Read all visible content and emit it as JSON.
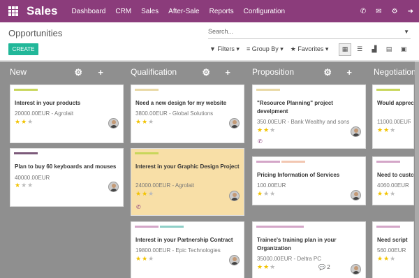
{
  "app": {
    "brand": "Sales",
    "apps_icon": "grid-icon"
  },
  "nav": [
    "Dashboard",
    "CRM",
    "Sales",
    "After-Sale",
    "Reports",
    "Configuration"
  ],
  "top_icons": [
    "phone-icon",
    "mail-icon",
    "gear-icon",
    "logout-icon"
  ],
  "page": {
    "title": "Opportunities",
    "create_label": "CREATE"
  },
  "search": {
    "placeholder": "Search..."
  },
  "filters": {
    "filters": "Filters",
    "group_by": "Group By",
    "favorites": "Favorites"
  },
  "views": [
    "kanban-view-icon",
    "list-view-icon",
    "graph-view-icon",
    "calendar-view-icon",
    "pivot-view-icon"
  ],
  "colors": {
    "topbar": "#8b3c7b",
    "create": "#21b799",
    "board": "#8f8f8f",
    "highlight": "#f8dfa7",
    "star": "#f2c300"
  },
  "columns": [
    {
      "title": "New",
      "cards": [
        {
          "title": "Interest in your products",
          "sub": "20000.00EUR - Agrolait",
          "stars": 2,
          "tags": [
            "#c8d65b"
          ]
        },
        {
          "title": "Plan to buy 60 keyboards and mouses",
          "sub": "40000.00EUR",
          "stars": 1,
          "tags": [
            "#7c5a7a"
          ]
        }
      ]
    },
    {
      "title": "Qualification",
      "cards": [
        {
          "title": "Need a new design for my website",
          "sub": "3800.00EUR - Global Solutions",
          "stars": 2,
          "tags": [
            "#e9d9a5"
          ]
        },
        {
          "title": "Interest in your Graphic Design Project",
          "sub": "24000.00EUR - Agrolait",
          "stars": 2,
          "tags": [
            "#c8d65b"
          ],
          "highlight": true,
          "phone": true
        },
        {
          "title": "Interest in your Partnership Contract",
          "sub": "19800.00EUR - Epic Technologies",
          "stars": 2,
          "tags": [
            "#d4a6c8",
            "#8fd0c8"
          ]
        }
      ]
    },
    {
      "title": "Proposition",
      "cards": [
        {
          "title": "\"Resource Planning\" project develpment",
          "sub": "350.00EUR - Bank Wealthy and sons",
          "stars": 2,
          "tags": [
            "#e9d9a5"
          ],
          "phone": true
        },
        {
          "title": "Pricing Information of Services",
          "sub": "100.00EUR",
          "stars": 1,
          "tags": [
            "#d4a6c8",
            "#f2c7b2"
          ]
        },
        {
          "title": "Trainee's training plan in your Organization",
          "sub": "35000.00EUR - Deltra PC",
          "stars": 2,
          "tags": [
            "#d4a6c8"
          ],
          "messages": "2"
        }
      ]
    },
    {
      "title": "Negotiation",
      "cards": [
        {
          "title": "Would appreciate a demo",
          "sub": "11000.00EUR",
          "stars": 2,
          "tags": [
            "#c8d65b"
          ]
        },
        {
          "title": "Need to customize",
          "sub": "4060.00EUR",
          "stars": 2,
          "tags": [
            "#d4a6c8"
          ]
        },
        {
          "title": "Need script",
          "sub": "560.00EUR",
          "stars": 2,
          "tags": [
            "#d4a6c8"
          ]
        }
      ]
    }
  ]
}
